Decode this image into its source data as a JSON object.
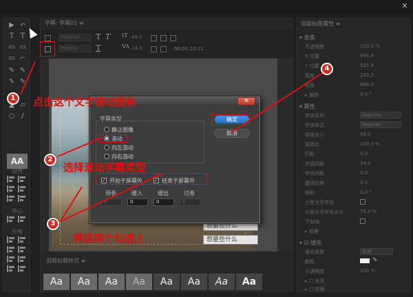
{
  "window": {
    "close_glyph": "✕"
  },
  "tools": {
    "items": [
      "▶",
      "↶",
      "T",
      "T",
      "▭",
      "▭",
      "▭",
      "⌐",
      "✎",
      "✎",
      "✎",
      "✎",
      "▲",
      "▱",
      "○",
      "/"
    ],
    "style_swatch": "AA",
    "align_label": "对齐",
    "center_label": "中心",
    "distribute_label": "分布"
  },
  "center": {
    "tab_label": "字幕: 字幕01 ≡",
    "toolbar": {
      "font_family": "Algerian",
      "font_style": "Regular",
      "font_size": "49.0",
      "kerning": "24.0",
      "timecode": "00:00:10:11"
    },
    "preview_lines": [
      "想要些什么",
      "想要些什么"
    ],
    "styles_label": "旧版标题样式 ≡",
    "style_samples": [
      "Aa",
      "Aa",
      "Aa",
      "Aa",
      "Aa",
      "Aa",
      "Aa",
      "Aa"
    ]
  },
  "properties": {
    "header": "旧版标题属性 ≡",
    "transform_label": "▾ 变换",
    "transform": [
      {
        "label": "不透明度",
        "value": "100.0 %"
      },
      {
        "label": "X 位置",
        "value": "994.8"
      },
      {
        "label": "Y 位置",
        "value": "525.9"
      },
      {
        "label": "宽度",
        "value": "290.2"
      },
      {
        "label": "高度",
        "value": "886.0"
      },
      {
        "label": "▸ 旋转",
        "value": "0.0 °"
      }
    ],
    "props_label": "▾ 属性",
    "props": [
      {
        "label": "字体系列",
        "value": "Algerian"
      },
      {
        "label": "字体样式",
        "value": "Regular"
      },
      {
        "label": "字体大小",
        "value": "49.0"
      },
      {
        "label": "宽高比",
        "value": "100.0 %"
      },
      {
        "label": "行距",
        "value": "0.0"
      },
      {
        "label": "字偶间距",
        "value": "24.0"
      },
      {
        "label": "字符间距",
        "value": "0.0"
      },
      {
        "label": "基线位移",
        "value": "0.0"
      },
      {
        "label": "倾斜",
        "value": "0.0 °"
      },
      {
        "label": "小型大写字母",
        "value": ""
      },
      {
        "label": "小型大写字母大小",
        "value": "75.0 %"
      },
      {
        "label": "下划线",
        "value": ""
      },
      {
        "label": "▸ 扭曲",
        "value": ""
      }
    ],
    "fill_label": "▾ ☑ 填充",
    "fill": [
      {
        "label": "填充类型",
        "value": "实底"
      },
      {
        "label": "颜色",
        "value": ""
      },
      {
        "label": "不透明度",
        "value": "100 %"
      },
      {
        "label": "▸ ☐ 光泽",
        "value": ""
      },
      {
        "label": "▸ ☐ 纹理",
        "value": ""
      }
    ]
  },
  "dialog": {
    "close_label": "✕",
    "group_label": "字幕类型",
    "radios": [
      {
        "label": "静止图像",
        "selected": false
      },
      {
        "label": "滚动",
        "selected": true
      },
      {
        "label": "向左游动",
        "selected": false
      },
      {
        "label": "向右游动",
        "selected": false
      }
    ],
    "start_offscreen": {
      "label": "开始于屏幕外",
      "checked": true,
      "mark": "✓"
    },
    "end_offscreen": {
      "label": "结束于屏幕外",
      "checked": true,
      "mark": "✓"
    },
    "columns": [
      {
        "label": "预卷",
        "value": "0",
        "enabled": false
      },
      {
        "label": "缓入",
        "value": "0",
        "enabled": true
      },
      {
        "label": "缓出",
        "value": "0",
        "enabled": true
      },
      {
        "label": "过卷",
        "value": "0",
        "enabled": false
      }
    ],
    "ok_label": "确定",
    "cancel_label": "取消"
  },
  "annotations": {
    "step1": {
      "number": "1",
      "text": "点击这个文字滚动图标"
    },
    "step2": {
      "number": "2",
      "text": "选择滚动字幕类型"
    },
    "step3": {
      "number": "3",
      "text": "将这两个勾选上"
    },
    "step4": {
      "number": "4"
    },
    "color": "#e01010"
  }
}
